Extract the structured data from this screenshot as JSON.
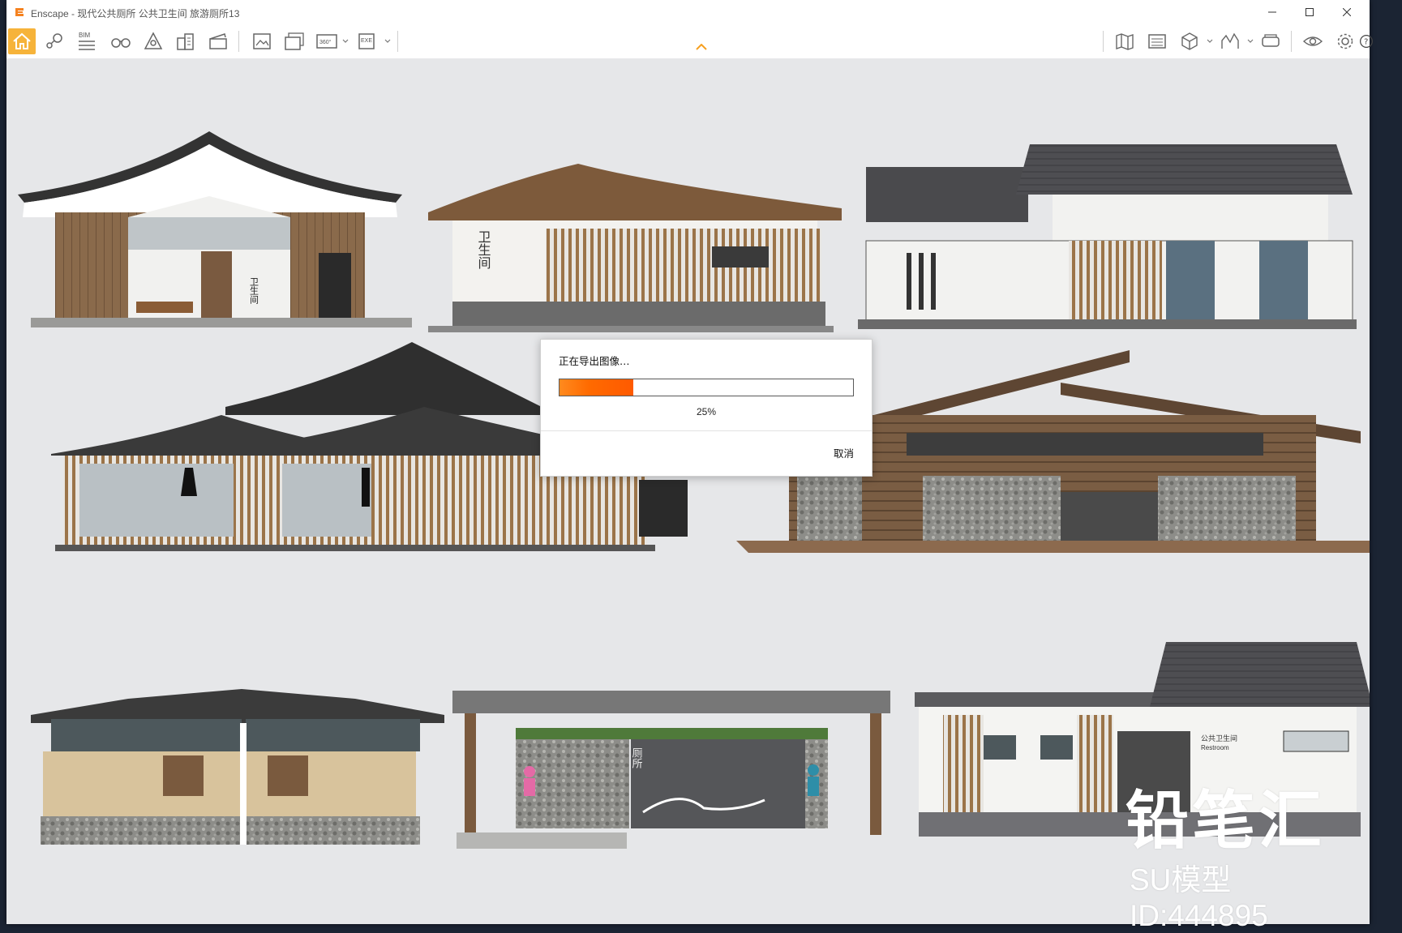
{
  "window": {
    "title": "Enscape - 现代公共厕所 公共卫生间 旅游厕所13",
    "accent": "#f6b33a"
  },
  "toolbar": {
    "left_icons": [
      "home-icon",
      "location-icon",
      "bim-icon",
      "binoculars-icon",
      "asset-icon",
      "buildings-icon",
      "video-editor-icon",
      "screenshot-icon",
      "batch-render-icon",
      "panorama-icon",
      "exe-export-icon"
    ],
    "right_icons": [
      "map-icon",
      "material-editor-icon",
      "cube-icon",
      "atmosphere-icon",
      "vr-headset-icon",
      "visibility-icon",
      "settings-icon",
      "help-icon"
    ],
    "bim_label": "BIM",
    "panorama_label": "360°",
    "exe_label": "EXE"
  },
  "scene_labels": {
    "toilet_sign": "卫生间",
    "restroom_cn": "公共卫生间",
    "restroom_en": "Restroom",
    "wc_sign": "厕所"
  },
  "dialog": {
    "title": "正在导出图像…",
    "progress": 0.25,
    "progress_text": "25%",
    "cancel": "取消"
  },
  "watermark": {
    "brand": "铅笔汇",
    "model_id": "SU模型ID:444895"
  }
}
